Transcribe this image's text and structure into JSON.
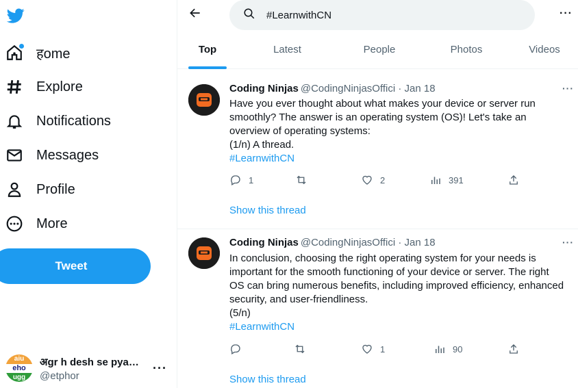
{
  "nav": {
    "items": [
      {
        "label": "हome"
      },
      {
        "label": "Explore"
      },
      {
        "label": "Notifications"
      },
      {
        "label": "Messages"
      },
      {
        "label": "Profile"
      },
      {
        "label": "More"
      }
    ],
    "tweet_label": "Tweet"
  },
  "account": {
    "avatar_lines": [
      "aiu",
      "eho",
      "ugg"
    ],
    "name": "अgr h desh se pyaar toh...",
    "handle": "@etphor"
  },
  "search": {
    "query": "#LearnwithCN"
  },
  "tabs": [
    {
      "label": "Top"
    },
    {
      "label": "Latest"
    },
    {
      "label": "People"
    },
    {
      "label": "Photos"
    },
    {
      "label": "Videos"
    }
  ],
  "tweets": [
    {
      "name": "Coding Ninjas",
      "meta": "@CodingNinjasOffici · Jan 18",
      "body": [
        "Have you ever thought about what makes your device or server run smoothly? The answer is an operating system (OS)! Let's take an overview of operating systems:",
        "(1/n) A thread."
      ],
      "hashtag": "#LearnwithCN",
      "replies": "1",
      "retweets": "",
      "likes": "2",
      "views": "391",
      "show_thread": "Show this thread"
    },
    {
      "name": "Coding Ninjas",
      "meta": "@CodingNinjasOffici · Jan 18",
      "body": [
        "In conclusion, choosing the right operating system for your needs is important for the smooth functioning of your device or server. The right OS can bring numerous benefits, including improved efficiency, enhanced security, and user-friendliness.",
        "(5/n)"
      ],
      "hashtag": "#LearnwithCN",
      "replies": "",
      "retweets": "",
      "likes": "1",
      "views": "90",
      "show_thread": "Show this thread"
    }
  ],
  "colors": {
    "accent": "#1d9bf0",
    "text": "#0f1419",
    "muted": "#536471"
  }
}
